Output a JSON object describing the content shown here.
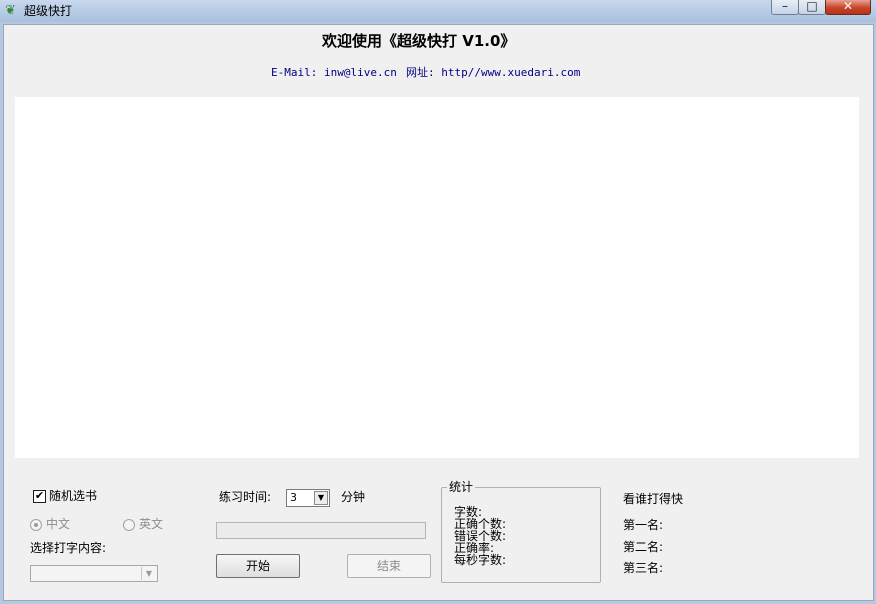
{
  "window": {
    "title": "超级快打",
    "minimize_glyph": "–",
    "maximize_glyph": "□",
    "close_glyph": "✕"
  },
  "header": {
    "heading": "欢迎使用《超级快打 V1.0》",
    "email": "E-Mail: inw@live.cn",
    "website": "网址: http//www.xuedari.com"
  },
  "options": {
    "random_book_label": "随机选书",
    "random_book_checked": true,
    "lang_chinese": "中文",
    "lang_english": "英文",
    "select_content_label": "选择打字内容:"
  },
  "practice": {
    "time_label": "练习时间:",
    "time_value": "3",
    "time_unit": "分钟",
    "start_label": "开始",
    "end_label": "结束"
  },
  "stats": {
    "group_title": "统计",
    "chars_label": "字数:",
    "correct_label": "正确个数:",
    "errors_label": "错误个数:",
    "accuracy_label": "正确率:",
    "speed_label": "每秒字数:"
  },
  "leaderboard": {
    "title": "看谁打得快",
    "first": "第一名:",
    "second": "第二名:",
    "third": "第三名:"
  },
  "colors": {
    "link_blue": "#000080",
    "background": "#f0f0f0"
  },
  "icons": {
    "app": "leaf-icon",
    "checkmark": "✔",
    "dropdown": "▼"
  }
}
